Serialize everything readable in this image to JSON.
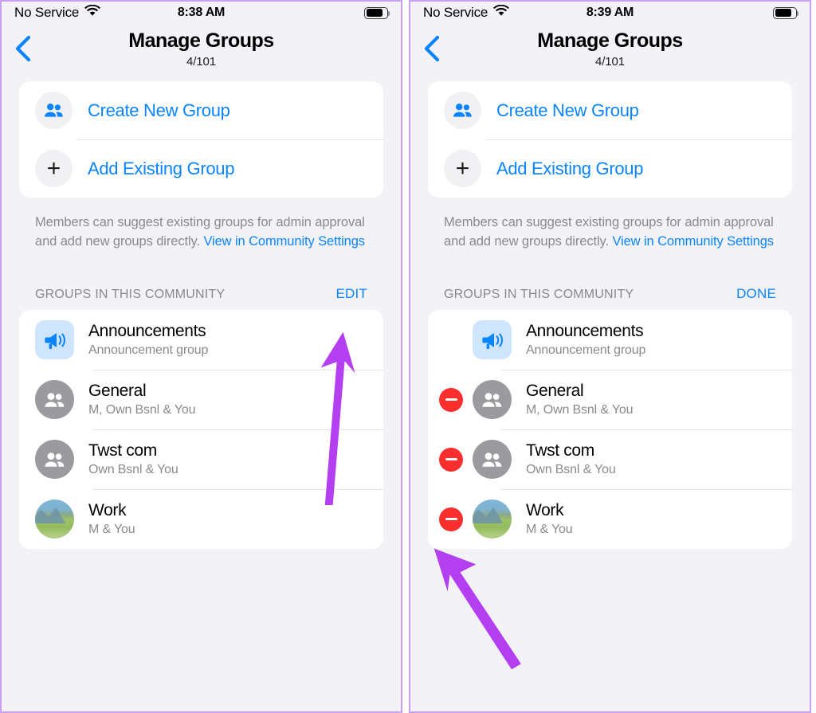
{
  "colors": {
    "accent_blue": "#0a84ff",
    "delete_red": "#fb2e2e",
    "annotation_purple": "#b33ff0",
    "panel_background": "#f2f2f7",
    "card_white": "#ffffff",
    "secondary_text": "#8a8a8e",
    "panel_border": "#c9a0f5"
  },
  "panels": [
    {
      "id": "left",
      "status_bar": {
        "carrier": "No Service",
        "wifi_icon": "wifi-icon",
        "time": "8:38 AM",
        "battery_icon": "battery-icon"
      },
      "nav": {
        "back_icon": "chevron-left-icon",
        "title": "Manage Groups",
        "subtitle": "4/101"
      },
      "actions": [
        {
          "icon": "people-icon",
          "label": "Create New Group"
        },
        {
          "icon": "plus-icon",
          "label": "Add Existing Group"
        }
      ],
      "helper": {
        "text_before": "Members can suggest existing groups for admin approval and add new groups directly. ",
        "link": "View in Community Settings"
      },
      "section": {
        "title": "GROUPS IN THIS COMMUNITY",
        "action": "EDIT"
      },
      "groups": [
        {
          "avatar": "megaphone-icon",
          "avatar_type": "announce",
          "name": "Announcements",
          "subtitle": "Announcement group",
          "deletable": false
        },
        {
          "avatar": "people-icon",
          "avatar_type": "people",
          "name": "General",
          "subtitle": "M, Own Bsnl & You",
          "deletable": false
        },
        {
          "avatar": "people-icon",
          "avatar_type": "people",
          "name": "Twst com",
          "subtitle": "Own Bsnl & You",
          "deletable": false
        },
        {
          "avatar": "landscape-photo",
          "avatar_type": "photo",
          "name": "Work",
          "subtitle": "M & You",
          "deletable": false
        }
      ],
      "annotation": {
        "target": "EDIT",
        "shape": "up-arrow"
      }
    },
    {
      "id": "right",
      "status_bar": {
        "carrier": "No Service",
        "wifi_icon": "wifi-icon",
        "time": "8:39 AM",
        "battery_icon": "battery-icon"
      },
      "nav": {
        "back_icon": "chevron-left-icon",
        "title": "Manage Groups",
        "subtitle": "4/101"
      },
      "actions": [
        {
          "icon": "people-icon",
          "label": "Create New Group"
        },
        {
          "icon": "plus-icon",
          "label": "Add Existing Group"
        }
      ],
      "helper": {
        "text_before": "Members can suggest existing groups for admin approval and add new groups directly. ",
        "link": "View in Community Settings"
      },
      "section": {
        "title": "GROUPS IN THIS COMMUNITY",
        "action": "DONE"
      },
      "groups": [
        {
          "avatar": "megaphone-icon",
          "avatar_type": "announce",
          "name": "Announcements",
          "subtitle": "Announcement group",
          "deletable": false
        },
        {
          "avatar": "people-icon",
          "avatar_type": "people",
          "name": "General",
          "subtitle": "M, Own Bsnl & You",
          "deletable": true
        },
        {
          "avatar": "people-icon",
          "avatar_type": "people",
          "name": "Twst com",
          "subtitle": "Own Bsnl & You",
          "deletable": true
        },
        {
          "avatar": "landscape-photo",
          "avatar_type": "photo",
          "name": "Work",
          "subtitle": "M & You",
          "deletable": true
        }
      ],
      "annotation": {
        "target": "Work delete button",
        "shape": "diagonal-arrow"
      }
    }
  ]
}
